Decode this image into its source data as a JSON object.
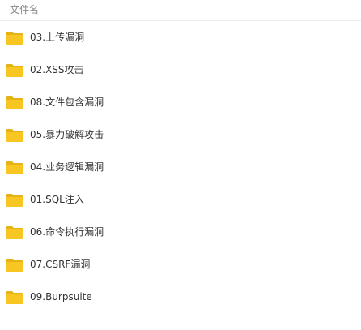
{
  "header": {
    "column_label": "文件名"
  },
  "colors": {
    "folder": "#f7c623",
    "folder_tab": "#e6b215",
    "text": "#333333",
    "header_text": "#888888"
  },
  "files": [
    {
      "name": "03.上传漏洞",
      "icon": "folder-icon"
    },
    {
      "name": "02.XSS攻击",
      "icon": "folder-icon"
    },
    {
      "name": "08.文件包含漏洞",
      "icon": "folder-icon"
    },
    {
      "name": "05.暴力破解攻击",
      "icon": "folder-icon"
    },
    {
      "name": "04.业务逻辑漏洞",
      "icon": "folder-icon"
    },
    {
      "name": "01.SQL注入",
      "icon": "folder-icon"
    },
    {
      "name": "06.命令执行漏洞",
      "icon": "folder-icon"
    },
    {
      "name": "07.CSRF漏洞",
      "icon": "folder-icon"
    },
    {
      "name": "09.Burpsuite",
      "icon": "folder-icon"
    }
  ]
}
